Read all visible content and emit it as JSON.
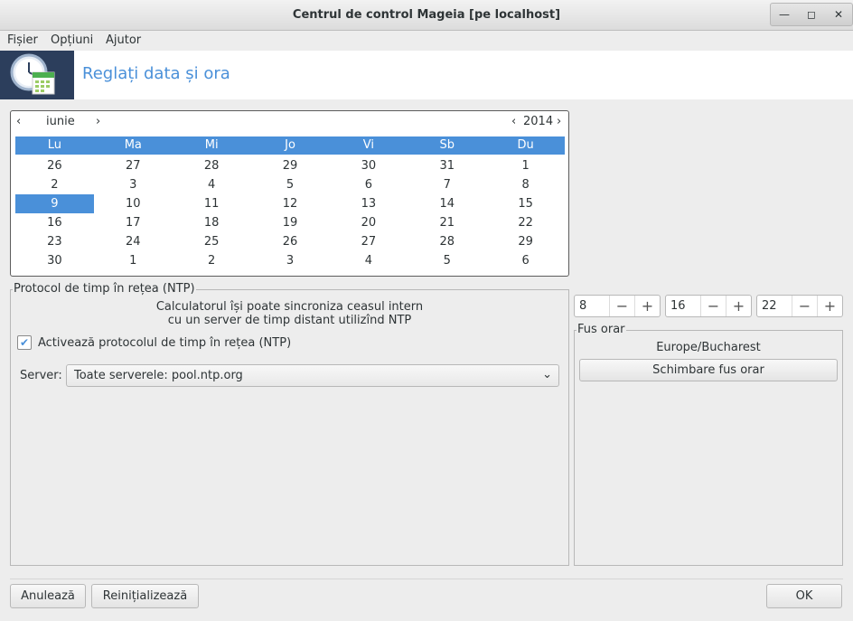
{
  "window": {
    "title": "Centrul de control Mageia  [pe localhost]"
  },
  "menu": {
    "items": [
      "Fișier",
      "Opțiuni",
      "Ajutor"
    ]
  },
  "header": {
    "title": "Reglați data și ora"
  },
  "calendar": {
    "month": "iunie",
    "year": "2014",
    "weekdays": [
      "Lu",
      "Ma",
      "Mi",
      "Jo",
      "Vi",
      "Sb",
      "Du"
    ],
    "weeks": [
      [
        "26",
        "27",
        "28",
        "29",
        "30",
        "31",
        "1"
      ],
      [
        "2",
        "3",
        "4",
        "5",
        "6",
        "7",
        "8"
      ],
      [
        "9",
        "10",
        "11",
        "12",
        "13",
        "14",
        "15"
      ],
      [
        "16",
        "17",
        "18",
        "19",
        "20",
        "21",
        "22"
      ],
      [
        "23",
        "24",
        "25",
        "26",
        "27",
        "28",
        "29"
      ],
      [
        "30",
        "1",
        "2",
        "3",
        "4",
        "5",
        "6"
      ]
    ],
    "selected_day": "9"
  },
  "ntp": {
    "legend": "Protocol de timp în rețea (NTP)",
    "info_line1": "Calculatorul își poate sincroniza ceasul intern",
    "info_line2": "cu un server de timp distant utilizînd NTP",
    "checkbox_label": "Activează protocolul de timp în rețea (NTP)",
    "checkbox_checked": true,
    "server_label": "Server:",
    "server_value": "Toate serverele: pool.ntp.org"
  },
  "time": {
    "hour": "8",
    "minute": "16",
    "second": "22"
  },
  "timezone": {
    "legend": "Fus orar",
    "name": "Europe/Bucharest",
    "change_button": "Schimbare fus orar"
  },
  "buttons": {
    "cancel": "Anulează",
    "reset": "Reinițializează",
    "ok": "OK"
  },
  "colors": {
    "accent": "#4a90d9",
    "logo_bg": "#2c3e5c"
  }
}
